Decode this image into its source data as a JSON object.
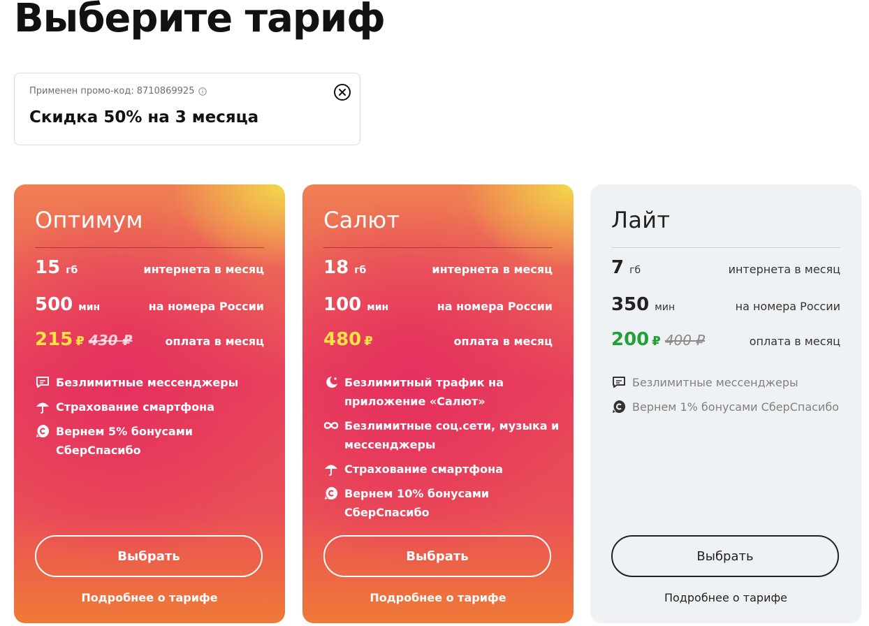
{
  "page": {
    "title": "Выберите тариф"
  },
  "promo": {
    "label": "Применен промо-код:",
    "code": "8710869925",
    "title": "Скидка 50% на 3 месяца",
    "info_icon": "info-icon",
    "close_icon": "close-circle-icon"
  },
  "tariffs": [
    {
      "name": "Оптимум",
      "internet_value": "15",
      "internet_unit": "гб",
      "internet_desc": "интернета в месяц",
      "minutes_value": "500",
      "minutes_unit": "мин",
      "minutes_desc": "на номера России",
      "price": "215",
      "currency": "₽",
      "old_price": "430 ₽",
      "price_desc": "оплата в месяц",
      "features": [
        {
          "icon": "chat-icon",
          "text": "Безлимитные мессенджеры"
        },
        {
          "icon": "umbrella-icon",
          "text": "Страхование смартфона"
        },
        {
          "icon": "sberspasibo-icon",
          "text": "Вернем 5% бонусами СберСпасибо"
        }
      ],
      "button": "Выбрать",
      "more": "Подробнее о тарифе"
    },
    {
      "name": "Салют",
      "internet_value": "18",
      "internet_unit": "гб",
      "internet_desc": "интернета в месяц",
      "minutes_value": "100",
      "minutes_unit": "мин",
      "minutes_desc": "на номера России",
      "price": "480",
      "currency": "₽",
      "old_price": "",
      "price_desc": "оплата в месяц",
      "features": [
        {
          "icon": "salut-icon",
          "text_line1": "Безлимитный трафик на",
          "text_line2": "приложение «Салют»"
        },
        {
          "icon": "infinity-icon",
          "text_line1": "Безлимитные соц.сети, музыка и",
          "text_line2": "мессенджеры"
        },
        {
          "icon": "umbrella-icon",
          "text": "Страхование смартфона"
        },
        {
          "icon": "sberspasibo-icon",
          "text": "Вернем 10% бонусами СберСпасибо"
        }
      ],
      "button": "Выбрать",
      "more": "Подробнее о тарифе"
    },
    {
      "name": "Лайт",
      "internet_value": "7",
      "internet_unit": "гб",
      "internet_desc": "интернета в месяц",
      "minutes_value": "350",
      "minutes_unit": "мин",
      "minutes_desc": "на номера России",
      "price": "200",
      "currency": "₽",
      "old_price": "400 ₽",
      "price_desc": "оплата в месяц",
      "features": [
        {
          "icon": "chat-icon",
          "text": "Безлимитные мессенджеры"
        },
        {
          "icon": "sberspasibo-icon",
          "text": "Вернем 1% бонусами СберСпасибо"
        }
      ],
      "button": "Выбрать",
      "more": "Подробнее о тарифе"
    }
  ],
  "colors": {
    "accent_yellow": "#ffe245",
    "accent_green": "#21a038",
    "card_gray": "#eff2f5"
  }
}
